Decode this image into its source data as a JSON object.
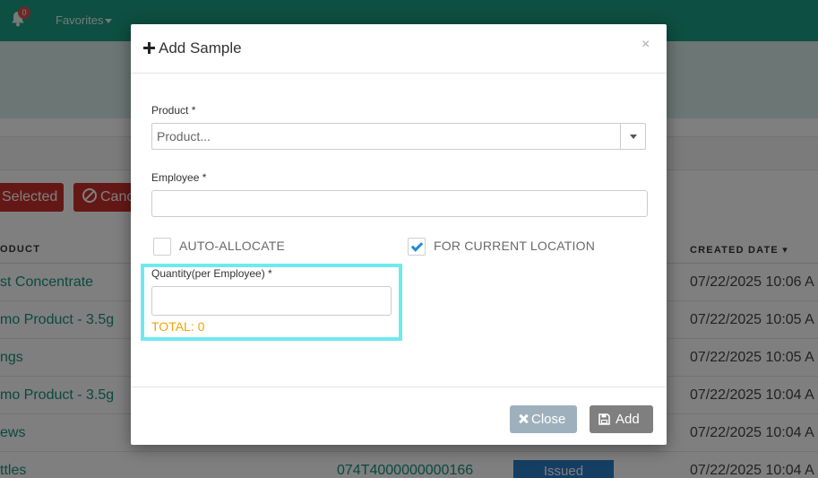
{
  "topbar": {
    "notification_count": "0",
    "favorites_label": "Favorites"
  },
  "toolbar": {
    "selected_label": "Selected",
    "cancel_label": "Canc"
  },
  "table": {
    "columns": {
      "product": "ODUCT",
      "created_date": "CREATED DATE ▾"
    },
    "rows": [
      {
        "name": "st Concentrate",
        "code": "",
        "status": "",
        "date": "07/22/2025 10:06 A"
      },
      {
        "name": "mo Product - 3.5g",
        "code": "",
        "status": "",
        "date": "07/22/2025 10:05 A"
      },
      {
        "name": "ngs",
        "code": "",
        "status": "",
        "date": "07/22/2025 10:05 A"
      },
      {
        "name": "mo Product - 3.5g",
        "code": "",
        "status": "",
        "date": "07/22/2025 10:04 A"
      },
      {
        "name": "ews",
        "code": "",
        "status": "",
        "date": "07/22/2025 10:04 A"
      },
      {
        "name": "ttles",
        "code": "074T4000000000166",
        "status": "Issued",
        "date": "07/22/2025 10:04 A"
      }
    ]
  },
  "modal": {
    "title": "Add Sample",
    "product_label": "Product *",
    "product_placeholder": "Product...",
    "employee_label": "Employee *",
    "employee_value": "",
    "auto_allocate_label": "AUTO-ALLOCATE",
    "auto_allocate_checked": false,
    "current_location_label": "FOR CURRENT LOCATION",
    "current_location_checked": true,
    "quantity_label": "Quantity(per Employee) *",
    "quantity_value": "",
    "total_text": "TOTAL: 0",
    "close_x": "×",
    "close_button": "Close",
    "add_button": "Add"
  },
  "colors": {
    "brand": "#1a9e84",
    "link": "#17937a",
    "danger": "#c9302c",
    "status_blue": "#2a7cc7",
    "highlight": "#6fe9ef",
    "total": "#f0a30a",
    "check": "#1e8ed8"
  }
}
